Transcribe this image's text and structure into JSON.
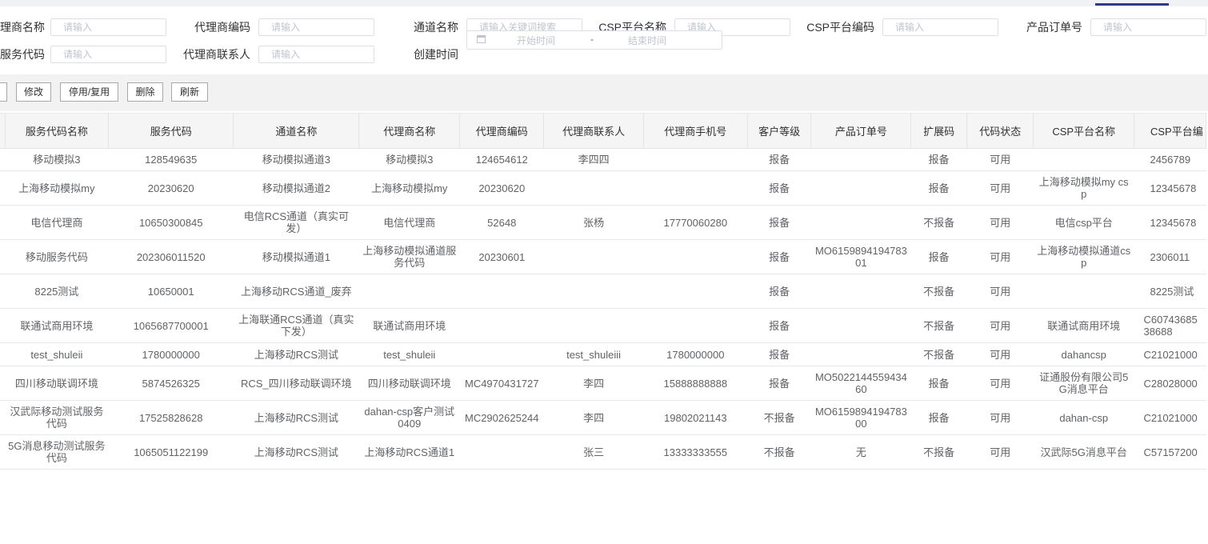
{
  "filters": {
    "row1": [
      {
        "label": "理商名称",
        "placeholder": "请输入"
      },
      {
        "label": "代理商编码",
        "placeholder": "请输入"
      },
      {
        "label": "通道名称",
        "placeholder": "请输入关键词搜索"
      },
      {
        "label": "CSP平台名称",
        "placeholder": "请输入"
      },
      {
        "label": "CSP平台编码",
        "placeholder": "请输入"
      },
      {
        "label": "产品订单号",
        "placeholder": "请输入"
      }
    ],
    "row2": [
      {
        "label": "服务代码",
        "placeholder": "请输入"
      },
      {
        "label": "代理商联系人",
        "placeholder": "请输入"
      }
    ],
    "created_time": {
      "label": "创建时间",
      "start_placeholder": "开始时间",
      "separator": "-",
      "end_placeholder": "结束时间",
      "icon": "calendar-icon"
    }
  },
  "toolbar": {
    "edit_label": "修改",
    "toggle_label": "停用/复用",
    "delete_label": "删除",
    "refresh_label": "刷新"
  },
  "table": {
    "columns": [
      "服务代码名称",
      "服务代码",
      "通道名称",
      "代理商名称",
      "代理商编码",
      "代理商联系人",
      "代理商手机号",
      "客户等级",
      "产品订单号",
      "扩展码",
      "代码状态",
      "CSP平台名称",
      "CSP平台编"
    ],
    "rows": [
      [
        "移动模拟3",
        "128549635",
        "移动模拟通道3",
        "移动模拟3",
        "124654612",
        "李四四",
        "",
        "报备",
        "",
        "报备",
        "可用",
        "",
        "2456789"
      ],
      [
        "上海移动模拟my",
        "20230620",
        "移动模拟通道2",
        "上海移动模拟my",
        "20230620",
        "",
        "",
        "报备",
        "",
        "报备",
        "可用",
        "上海移动模拟my csp",
        "12345678"
      ],
      [
        "电信代理商",
        "10650300845",
        "电信RCS通道（真实可发）",
        "电信代理商",
        "52648",
        "张杨",
        "17770060280",
        "报备",
        "",
        "不报备",
        "可用",
        "电信csp平台",
        "12345678"
      ],
      [
        "移动服务代码",
        "202306011520",
        "移动模拟通道1",
        "上海移动模拟通道服务代码",
        "20230601",
        "",
        "",
        "报备",
        "MO615989419478301",
        "报备",
        "可用",
        "上海移动模拟通道csp",
        "2306011"
      ],
      [
        "8225测试",
        "10650001",
        "上海移动RCS通道_废弃",
        "",
        "",
        "",
        "",
        "报备",
        "",
        "不报备",
        "可用",
        "",
        "8225测试"
      ],
      [
        "联通试商用环境",
        "1065687700001",
        "上海联通RCS通道（真实下发）",
        "联通试商用环境",
        "",
        "",
        "",
        "报备",
        "",
        "不报备",
        "可用",
        "联通试商用环境",
        "C6074368538688"
      ],
      [
        "test_shuleii",
        "1780000000",
        "上海移动RCS测试",
        "test_shuleii",
        "",
        "test_shuleiii",
        "1780000000",
        "报备",
        "",
        "不报备",
        "可用",
        "dahancsp",
        "C21021000"
      ],
      [
        "四川移动联调环境",
        "5874526325",
        "RCS_四川移动联调环境",
        "四川移动联调环境",
        "MC4970431727",
        "李四",
        "15888888888",
        "报备",
        "MO502214455943460",
        "报备",
        "可用",
        "证通股份有限公司5G消息平台",
        "C28028000"
      ],
      [
        "汉武际移动测试服务代码",
        "17525828628",
        "上海移动RCS测试",
        "dahan-csp客户测试0409",
        "MC2902625244",
        "李四",
        "19802021143",
        "不报备",
        "MO615989419478300",
        "报备",
        "可用",
        "dahan-csp",
        "C21021000"
      ],
      [
        "5G消息移动测试服务代码",
        "1065051122199",
        "上海移动RCS测试",
        "上海移动RCS通道1",
        "",
        "张三",
        "13333333555",
        "不报备",
        "无",
        "不报备",
        "可用",
        "汉武际5G消息平台",
        "C57157200"
      ]
    ]
  }
}
